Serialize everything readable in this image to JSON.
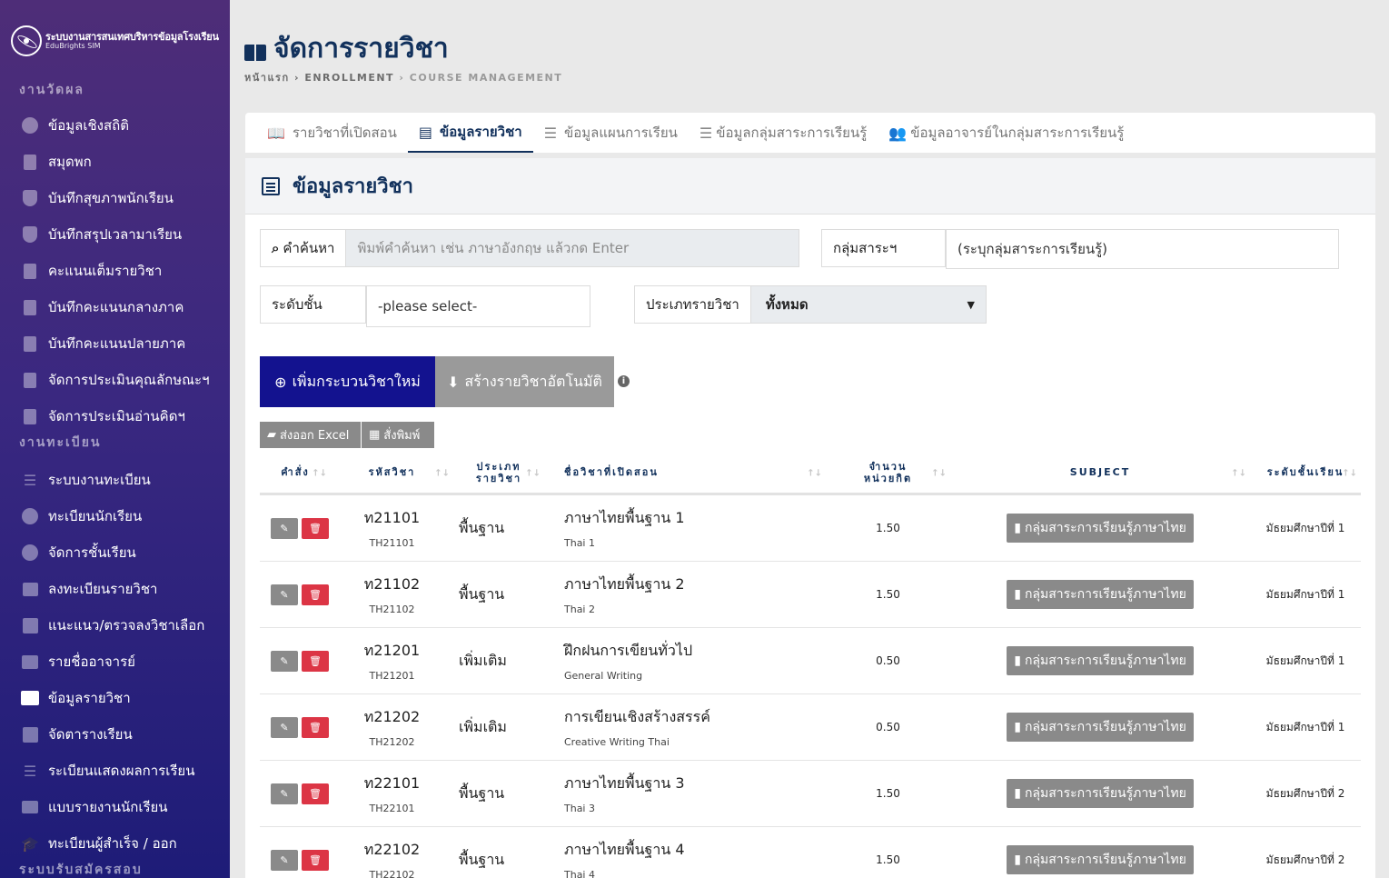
{
  "brand": {
    "title": "ระบบงานสารสนเทศบริหารข้อมูลโรงเรียน",
    "subtitle": "EduBrights SIM"
  },
  "sidebar": {
    "sections": [
      {
        "title": "งานวัดผล",
        "items": [
          {
            "label": "ข้อมูลเชิงสถิติ",
            "icon": "pie-chart-icon"
          },
          {
            "label": "สมุดพก",
            "icon": "book-icon"
          },
          {
            "label": "บันทึกสุขภาพนักเรียน",
            "icon": "shield-plus-icon"
          },
          {
            "label": "บันทึกสรุปเวลามาเรียน",
            "icon": "shield-plus-icon"
          },
          {
            "label": "คะแนนเต็มรายวิชา",
            "icon": "book-icon"
          },
          {
            "label": "บันทึกคะแนนกลางภาค",
            "icon": "book-icon"
          },
          {
            "label": "บันทึกคะแนนปลายภาค",
            "icon": "book-icon"
          },
          {
            "label": "จัดการประเมินคุณลักษณะฯ",
            "icon": "book-icon"
          },
          {
            "label": "จัดการประเมินอ่านคิดฯ",
            "icon": "book-icon"
          }
        ]
      },
      {
        "title": "งานทะเบียน",
        "items": [
          {
            "label": "ระบบงานทะเบียน",
            "icon": "list-icon"
          },
          {
            "label": "ทะเบียนนักเรียน",
            "icon": "face-icon"
          },
          {
            "label": "จัดการชั้นเรียน",
            "icon": "user-circle-icon"
          },
          {
            "label": "ลงทะเบียนรายวิชา",
            "icon": "checklist-icon"
          },
          {
            "label": "แนะแนว/ตรวจลงวิชาเลือก",
            "icon": "plus-box-icon"
          },
          {
            "label": "รายชื่ออาจารย์",
            "icon": "id-badge-icon"
          },
          {
            "label": "ข้อมูลรายวิชา",
            "icon": "open-book-icon",
            "active": true
          },
          {
            "label": "จัดตารางเรียน",
            "icon": "calendar-icon"
          },
          {
            "label": "ระเบียนแสดงผลการเรียน",
            "icon": "text-lines-icon"
          },
          {
            "label": "แบบรายงานนักเรียน",
            "icon": "printer-icon"
          },
          {
            "label": "ทะเบียนผู้สำเร็จ / ออก",
            "icon": "graduation-cap-icon"
          }
        ]
      },
      {
        "title": "ระบบรับสมัครสอบ",
        "items": []
      }
    ]
  },
  "page": {
    "title": "จัดการรายวิชา",
    "breadcrumb": {
      "home": "หน้าแรก",
      "level1": "ENROLLMENT",
      "level2": "COURSE MANAGEMENT"
    }
  },
  "tabs": [
    {
      "label": "รายวิชาที่เปิดสอน",
      "icon": "open-book-icon"
    },
    {
      "label": "ข้อมูลรายวิชา",
      "icon": "library-books-icon",
      "active": true
    },
    {
      "label": "ข้อมูลแผนการเรียน",
      "icon": "list-icon"
    },
    {
      "label": "ข้อมูลกลุ่มสาระการเรียนรู้",
      "icon": "list-ul-icon"
    },
    {
      "label": "ข้อมูลอาจารย์ในกลุ่มสาระการเรียนรู้",
      "icon": "users-icon"
    }
  ],
  "panel": {
    "title": "ข้อมูลรายวิชา"
  },
  "filters": {
    "search": {
      "label": "คำค้นหา",
      "placeholder": "พิมพ์คำค้นหา เช่น ภาษาอังกฤษ แล้วกด Enter"
    },
    "group": {
      "label": "กลุ่มสาระฯ",
      "value": "(ระบุกลุ่มสาระการเรียนรู้)"
    },
    "level": {
      "label": "ระดับชั้น",
      "value": "-please select-"
    },
    "type": {
      "label": "ประเภทรายวิชา",
      "value": "ทั้งหมด"
    }
  },
  "buttons": {
    "add": "เพิ่มกระบวนวิชาใหม่",
    "auto": "สร้างรายวิชาอัตโนมัติ",
    "excel": "ส่งออก Excel",
    "print": "สั่งพิมพ์"
  },
  "table": {
    "headers": {
      "command": "คำสั่ง",
      "code": "รหัสวิชา",
      "type_line1": "ประเภท",
      "type_line2": "รายวิชา",
      "name": "ชื่อวิชาที่เปิดสอน",
      "credit_line1": "จำนวน",
      "credit_line2": "หน่วยกิต",
      "subject": "SUBJECT",
      "level": "ระดับชั้นเรียน"
    },
    "rows": [
      {
        "code": "ท21101",
        "code_en": "TH21101",
        "type": "พื้นฐาน",
        "name": "ภาษาไทยพื้นฐาน 1",
        "name_en": "Thai 1",
        "credit": "1.50",
        "subject": "กลุ่มสาระการเรียนรู้ภาษาไทย",
        "level": "มัธยมศึกษาปีที่ 1"
      },
      {
        "code": "ท21102",
        "code_en": "TH21102",
        "type": "พื้นฐาน",
        "name": "ภาษาไทยพื้นฐาน 2",
        "name_en": "Thai 2",
        "credit": "1.50",
        "subject": "กลุ่มสาระการเรียนรู้ภาษาไทย",
        "level": "มัธยมศึกษาปีที่ 1"
      },
      {
        "code": "ท21201",
        "code_en": "TH21201",
        "type": "เพิ่มเติม",
        "name": "ฝึกฝนการเขียนทั่วไป",
        "name_en": "General Writing",
        "credit": "0.50",
        "subject": "กลุ่มสาระการเรียนรู้ภาษาไทย",
        "level": "มัธยมศึกษาปีที่ 1"
      },
      {
        "code": "ท21202",
        "code_en": "TH21202",
        "type": "เพิ่มเติม",
        "name": "การเขียนเชิงสร้างสรรค์",
        "name_en": "Creative Writing Thai",
        "credit": "0.50",
        "subject": "กลุ่มสาระการเรียนรู้ภาษาไทย",
        "level": "มัธยมศึกษาปีที่ 1"
      },
      {
        "code": "ท22101",
        "code_en": "TH22101",
        "type": "พื้นฐาน",
        "name": "ภาษาไทยพื้นฐาน 3",
        "name_en": "Thai 3",
        "credit": "1.50",
        "subject": "กลุ่มสาระการเรียนรู้ภาษาไทย",
        "level": "มัธยมศึกษาปีที่ 2"
      },
      {
        "code": "ท22102",
        "code_en": "TH22102",
        "type": "พื้นฐาน",
        "name": "ภาษาไทยพื้นฐาน 4",
        "name_en": "Thai 4",
        "credit": "1.50",
        "subject": "กลุ่มสาระการเรียนรู้ภาษาไทย",
        "level": "มัธยมศึกษาปีที่ 2"
      }
    ]
  },
  "colors": {
    "primary": "#13128f",
    "title": "#12315c",
    "danger": "#dc3545",
    "muted_button": "#8a8a8a"
  }
}
